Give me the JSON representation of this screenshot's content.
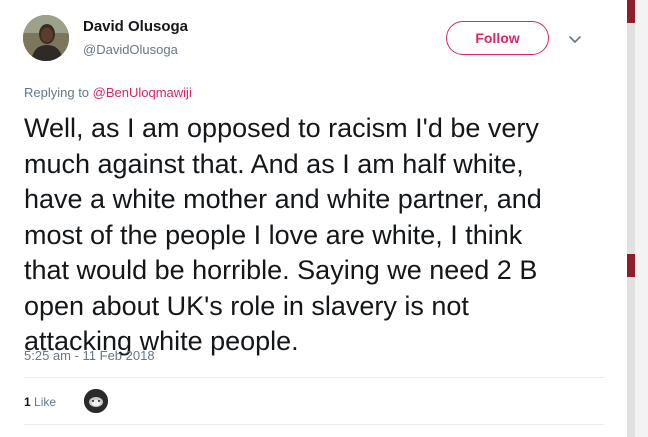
{
  "author": {
    "display_name": "David Olusoga",
    "screen_name": "@DavidOlusoga",
    "avatar_icon": "profile-photo"
  },
  "follow_button": {
    "label": "Follow",
    "color": "#e0245e"
  },
  "menu": {
    "icon": "chevron-down-icon"
  },
  "reply": {
    "prefix": "Replying to ",
    "handle": "@BenUloqmawiji"
  },
  "tweet": {
    "text": "Well, as I am opposed to racism I'd be very\nmuch against that. And as I am half white,\nhave a white mother and white partner, and\nmost of the people I love are white, I think\nthat would be horrible. Saying we need 2 B\nopen about UK's role in slavery is not\nattacking white people.",
    "timestamp": "5:25 am - 11 Feb 2018"
  },
  "stats": {
    "like_count": "1",
    "like_label": "Like"
  },
  "colors": {
    "accent": "#e0245e",
    "secondary_text": "#657786",
    "primary_text": "#14171a",
    "scroll_accent": "#8f1d2c"
  }
}
